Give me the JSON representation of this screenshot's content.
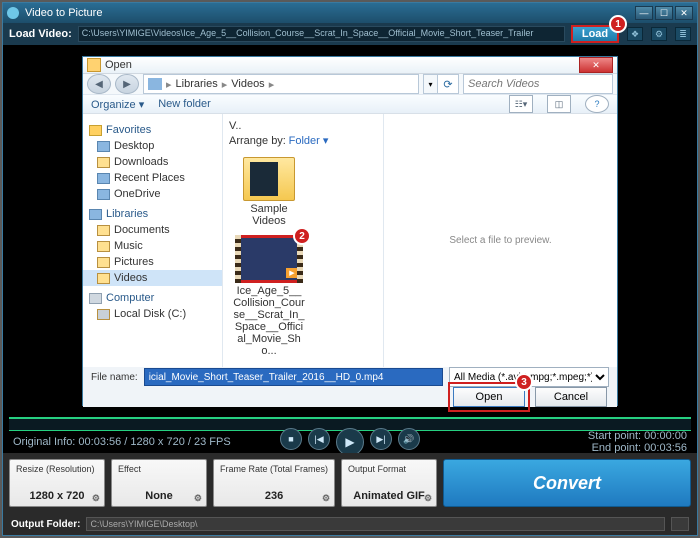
{
  "title": "Video to Picture",
  "loadbar": {
    "label": "Load Video:",
    "path": "C:\\Users\\YIMIGE\\Videos\\Ice_Age_5__Collision_Course__Scrat_In_Space__Official_Movie_Short_Teaser_Trailer",
    "button": "Load"
  },
  "badges": {
    "b1": "1",
    "b2": "2",
    "b3": "3"
  },
  "info": {
    "left": "Original Info: 00:03:56 / 1280 x 720 / 23 FPS",
    "r1": "Start point: 00:00:00",
    "r2": "End point: 00:03:56"
  },
  "panels": {
    "resize": {
      "label": "Resize (Resolution)",
      "value": "1280 x 720"
    },
    "effect": {
      "label": "Effect",
      "value": "None"
    },
    "frame": {
      "label": "Frame Rate (Total Frames)",
      "value": "236"
    },
    "format": {
      "label": "Output Format",
      "value": "Animated GIF"
    },
    "convert": "Convert"
  },
  "footer": {
    "label": "Output Folder:",
    "path": "C:\\Users\\YIMIGE\\Desktop\\"
  },
  "dialog": {
    "title": "Open",
    "crumbs": {
      "a": "Libraries",
      "b": "Videos"
    },
    "search_placeholder": "Search Videos",
    "toolbar": {
      "organize": "Organize ▾",
      "newfolder": "New folder"
    },
    "tree": {
      "fav": "Favorites",
      "desktop": "Desktop",
      "downloads": "Downloads",
      "recent": "Recent Places",
      "onedrive": "OneDrive",
      "lib": "Libraries",
      "docs": "Documents",
      "music": "Music",
      "pics": "Pictures",
      "videos": "Videos",
      "comp": "Computer",
      "c": "Local Disk (C:)"
    },
    "files": {
      "heading": "V..",
      "arrange": "Arrange by:",
      "arrangeval": "Folder ▾",
      "folder": "Sample Videos",
      "video": "Ice_Age_5__Collision_Course__Scrat_In_Space__Official_Movie_Sho..."
    },
    "preview": "Select a file to preview.",
    "filename_label": "File name:",
    "filename": "icial_Movie_Short_Teaser_Trailer_2016__HD_0.mp4",
    "filter": "All Media (*.avi;*.mpg;*.mpeg;*)",
    "open": "Open",
    "cancel": "Cancel"
  }
}
